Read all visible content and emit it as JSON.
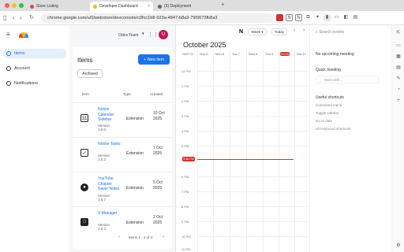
{
  "browser": {
    "tabs": [
      {
        "title": "Store Listing",
        "favicon_color": "#e8453c"
      },
      {
        "title": "Developer Dashboard",
        "favicon_color": "#fbbc04"
      },
      {
        "title": "(3) Deployment",
        "favicon_color": "#666666"
      }
    ],
    "url": "chrome.google.com/u/0/webstore/devconsole/c0fcc1b8-923a-4847-b8a3-79f3673fb8a3"
  },
  "sidebar": {
    "items": [
      {
        "label": "Items"
      },
      {
        "label": "Account"
      },
      {
        "label": "Notifications"
      }
    ]
  },
  "header": {
    "team": "Orbix Team",
    "avatar_letter": "U"
  },
  "items_page": {
    "title": "Items",
    "new_button": "New item",
    "archived_button": "Archived",
    "columns": [
      "Item",
      "Type",
      "Created"
    ],
    "rows": [
      {
        "name": "Notion Calendar Sidebar",
        "version_label": "Version",
        "version": "1.0.0",
        "type": "Extension",
        "date": "10 Oct 2025",
        "icon": "31"
      },
      {
        "name": "Notion Tasks",
        "version_label": "Version",
        "version": "1.0.2",
        "type": "Extension",
        "date": "7 Oct 2025",
        "icon": "✓"
      },
      {
        "name": "YouTube Chapter Saver Notes",
        "version_label": "Version",
        "version": "1.0.7",
        "type": "Extension",
        "date": "5 Oct 2025",
        "icon": "●"
      },
      {
        "name": "X Manager",
        "version_label": "Version",
        "version": "1.0.3",
        "type": "Extension",
        "date": "2 Oct 2025",
        "icon": "□"
      }
    ],
    "pager": "Items 1 - 4 of 4"
  },
  "calendar": {
    "month": "October 2025",
    "view": "Week",
    "today": "Today",
    "tz": "GMT+9",
    "days": [
      "Sun 5",
      "Mon 6",
      "Tue 7",
      "Wed 8",
      "Thu 9",
      "Fri 10",
      "Sat 11"
    ],
    "hours": [
      "12 PM",
      "1 PM",
      "2 PM",
      "3 PM",
      "4 PM",
      "5 PM",
      "6 PM",
      "7 PM",
      "8 PM",
      "9 PM",
      "10 PM",
      "11 PM"
    ],
    "now": "5:46 PM"
  },
  "right_panel": {
    "search_placeholder": "Search events",
    "no_meeting": "No upcoming meeting",
    "quick_meeting": "Quick meeting",
    "meet_with": "Meet with...",
    "useful_shortcuts": "Useful shortcuts",
    "shortcuts": [
      "Command menu",
      "Toggle sidebar",
      "Go to date",
      "All keyboard shortcuts"
    ]
  }
}
